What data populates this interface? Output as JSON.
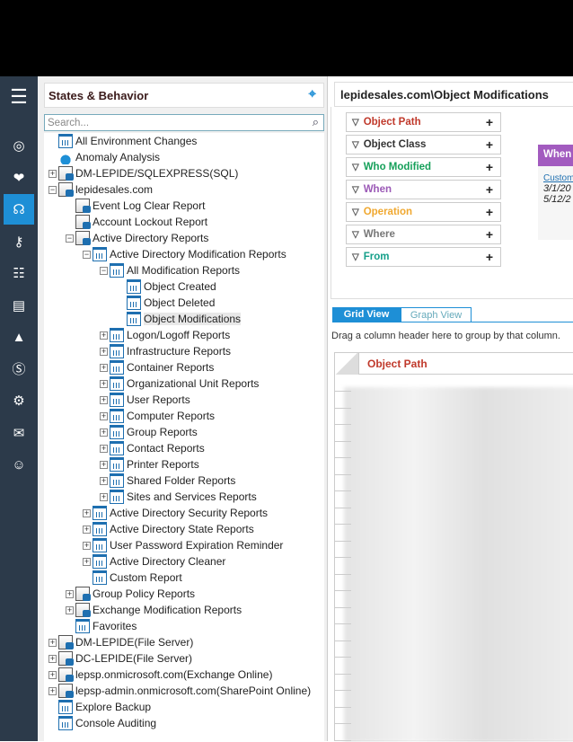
{
  "nav": {
    "icons": [
      "menu-icon",
      "dashboard-icon",
      "risk-icon",
      "states-behavior-icon",
      "key-icon",
      "directory-icon",
      "server-icon",
      "alert-icon",
      "settings-s-icon",
      "gear-icon",
      "mail-icon",
      "user-icon"
    ]
  },
  "left": {
    "title": "States & Behavior",
    "search_placeholder": "Search...",
    "tree": [
      {
        "label": "All Environment Changes",
        "level": 0,
        "exp": "",
        "icon": "rep"
      },
      {
        "label": "Anomaly Analysis",
        "level": 0,
        "exp": "",
        "icon": "anom"
      },
      {
        "label": "DM-LEPIDE/SQLEXPRESS(SQL)",
        "level": 0,
        "exp": "+",
        "icon": "srv"
      },
      {
        "label": "lepidesales.com",
        "level": 0,
        "exp": "-",
        "icon": "srv"
      },
      {
        "label": "Event Log Clear Report",
        "level": 1,
        "exp": "",
        "icon": "srv"
      },
      {
        "label": "Account Lockout Report",
        "level": 1,
        "exp": "",
        "icon": "srv"
      },
      {
        "label": "Active Directory Reports",
        "level": 1,
        "exp": "-",
        "icon": "srv"
      },
      {
        "label": "Active Directory Modification Reports",
        "level": 2,
        "exp": "-",
        "icon": "rep"
      },
      {
        "label": "All Modification Reports",
        "level": 3,
        "exp": "-",
        "icon": "rep"
      },
      {
        "label": "Object Created",
        "level": 4,
        "exp": "",
        "icon": "rep"
      },
      {
        "label": "Object Deleted",
        "level": 4,
        "exp": "",
        "icon": "rep"
      },
      {
        "label": "Object Modifications",
        "level": 4,
        "exp": "",
        "icon": "rep",
        "selected": true
      },
      {
        "label": "Logon/Logoff Reports",
        "level": 3,
        "exp": "+",
        "icon": "rep"
      },
      {
        "label": "Infrastructure Reports",
        "level": 3,
        "exp": "+",
        "icon": "rep"
      },
      {
        "label": "Container Reports",
        "level": 3,
        "exp": "+",
        "icon": "rep"
      },
      {
        "label": "Organizational Unit Reports",
        "level": 3,
        "exp": "+",
        "icon": "rep"
      },
      {
        "label": "User Reports",
        "level": 3,
        "exp": "+",
        "icon": "rep"
      },
      {
        "label": "Computer Reports",
        "level": 3,
        "exp": "+",
        "icon": "rep"
      },
      {
        "label": "Group Reports",
        "level": 3,
        "exp": "+",
        "icon": "rep"
      },
      {
        "label": "Contact Reports",
        "level": 3,
        "exp": "+",
        "icon": "rep"
      },
      {
        "label": "Printer Reports",
        "level": 3,
        "exp": "+",
        "icon": "rep"
      },
      {
        "label": "Shared Folder Reports",
        "level": 3,
        "exp": "+",
        "icon": "rep"
      },
      {
        "label": "Sites and Services Reports",
        "level": 3,
        "exp": "+",
        "icon": "rep"
      },
      {
        "label": "Active Directory Security Reports",
        "level": 2,
        "exp": "+",
        "icon": "rep"
      },
      {
        "label": "Active Directory State Reports",
        "level": 2,
        "exp": "+",
        "icon": "rep"
      },
      {
        "label": "User Password Expiration Reminder",
        "level": 2,
        "exp": "+",
        "icon": "rep"
      },
      {
        "label": "Active Directory Cleaner",
        "level": 2,
        "exp": "+",
        "icon": "rep"
      },
      {
        "label": "Custom Report",
        "level": 2,
        "exp": "",
        "icon": "rep"
      },
      {
        "label": "Group Policy Reports",
        "level": 1,
        "exp": "+",
        "icon": "srv"
      },
      {
        "label": "Exchange Modification Reports",
        "level": 1,
        "exp": "+",
        "icon": "srv"
      },
      {
        "label": "Favorites",
        "level": 1,
        "exp": "",
        "icon": "rep"
      },
      {
        "label": "DM-LEPIDE(File Server)",
        "level": 0,
        "exp": "+",
        "icon": "srv"
      },
      {
        "label": "DC-LEPIDE(File Server)",
        "level": 0,
        "exp": "+",
        "icon": "srv"
      },
      {
        "label": "lepsp.onmicrosoft.com(Exchange Online)",
        "level": 0,
        "exp": "+",
        "icon": "srv"
      },
      {
        "label": "lepsp-admin.onmicrosoft.com(SharePoint Online)",
        "level": 0,
        "exp": "+",
        "icon": "srv"
      },
      {
        "label": "Explore Backup",
        "level": 0,
        "exp": "",
        "icon": "rep"
      },
      {
        "label": "Console Auditing",
        "level": 0,
        "exp": "",
        "icon": "rep"
      }
    ]
  },
  "right": {
    "title": "lepidesales.com\\Object Modifications",
    "filters": [
      {
        "label": "Object Path",
        "color": "#c0392b"
      },
      {
        "label": "Object Class",
        "color": "#333333"
      },
      {
        "label": "Who Modified",
        "color": "#16a05a"
      },
      {
        "label": "When",
        "color": "#9b59b6"
      },
      {
        "label": "Operation",
        "color": "#f0a830"
      },
      {
        "label": "Where",
        "color": "#777777"
      },
      {
        "label": "From",
        "color": "#16a08a"
      }
    ],
    "when": {
      "header": "When",
      "custom": "Custom",
      "from": "3/1/20",
      "to": "5/12/2"
    },
    "tabs": {
      "grid": "Grid View",
      "graph": "Graph View"
    },
    "hint": "Drag a column header here to group by that column.",
    "column": "Object Path"
  }
}
